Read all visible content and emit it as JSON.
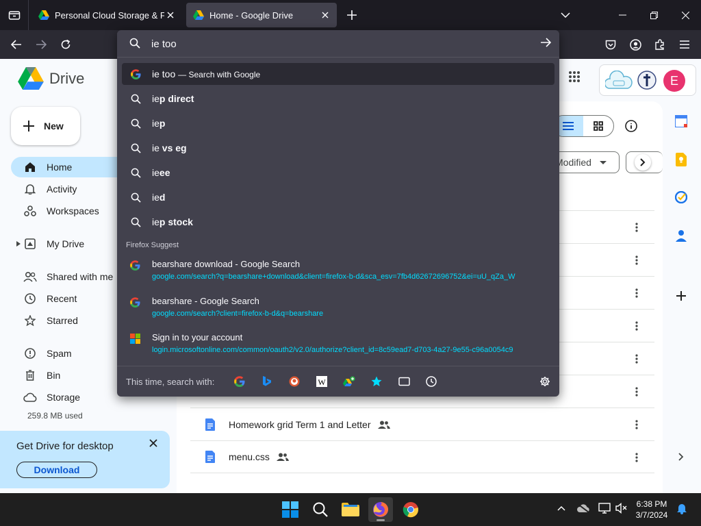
{
  "browser": {
    "tabs": [
      {
        "title": "Personal Cloud Storage & File S",
        "active": false
      },
      {
        "title": "Home - Google Drive",
        "active": true
      }
    ]
  },
  "urlbar": {
    "query": "ie too",
    "suggestions": [
      {
        "prefix": "ie too",
        "bold": "",
        "hint": "— Search with Google",
        "icon": "google-icon"
      },
      {
        "prefix": "ie",
        "bold": "p direct",
        "icon": "search-icon"
      },
      {
        "prefix": "ie",
        "bold": "p",
        "icon": "search-icon"
      },
      {
        "prefix": "ie ",
        "bold": "vs eg",
        "icon": "search-icon"
      },
      {
        "prefix": "ie",
        "bold": "ee",
        "icon": "search-icon"
      },
      {
        "prefix": "ie",
        "bold": "d",
        "icon": "search-icon"
      },
      {
        "prefix": "ie",
        "bold": "p stock",
        "icon": "search-icon"
      }
    ],
    "section_label": "Firefox Suggest",
    "firefox_suggest": [
      {
        "title": "bearshare download - Google Search",
        "url": "google.com/search?q=bearshare+download&client=firefox-b-d&sca_esv=7fb4d62672696752&ei=uU_qZa_W",
        "icon": "google-icon"
      },
      {
        "title": "bearshare - Google Search",
        "url": "google.com/search?client=firefox-b-d&q=bearshare",
        "icon": "google-icon"
      },
      {
        "title": "Sign in to your account",
        "url": "login.microsoftonline.com/common/oauth2/v2.0/authorize?client_id=8c59ead7-d703-4a27-9e55-c96a0054c9",
        "icon": "microsoft-icon"
      }
    ],
    "search_with_label": "This time, search with:"
  },
  "drive": {
    "logo_text": "Drive",
    "new_label": "New",
    "nav": [
      {
        "label": "Home",
        "icon": "home-icon",
        "active": true
      },
      {
        "label": "Activity",
        "icon": "bell-icon"
      },
      {
        "label": "Workspaces",
        "icon": "workspaces-icon"
      },
      {
        "label": "My Drive",
        "icon": "my-drive-icon"
      },
      {
        "label": "Shared with me",
        "icon": "people-icon"
      },
      {
        "label": "Recent",
        "icon": "clock-icon"
      },
      {
        "label": "Starred",
        "icon": "star-icon"
      },
      {
        "label": "Spam",
        "icon": "spam-icon"
      },
      {
        "label": "Bin",
        "icon": "bin-icon"
      },
      {
        "label": "Storage",
        "icon": "cloud-icon"
      }
    ],
    "storage_used": "259.8 MB used",
    "desktop_card": {
      "title": "Get Drive for desktop",
      "button": "Download"
    },
    "filter_modified": "Modified",
    "files": [
      {
        "name": "Homework grid Term 1 and Letter",
        "shared": true
      },
      {
        "name": "menu.css",
        "shared": true
      }
    ],
    "account_initial": "E"
  },
  "taskbar": {
    "time": "6:38 PM",
    "date": "3/7/2024"
  }
}
